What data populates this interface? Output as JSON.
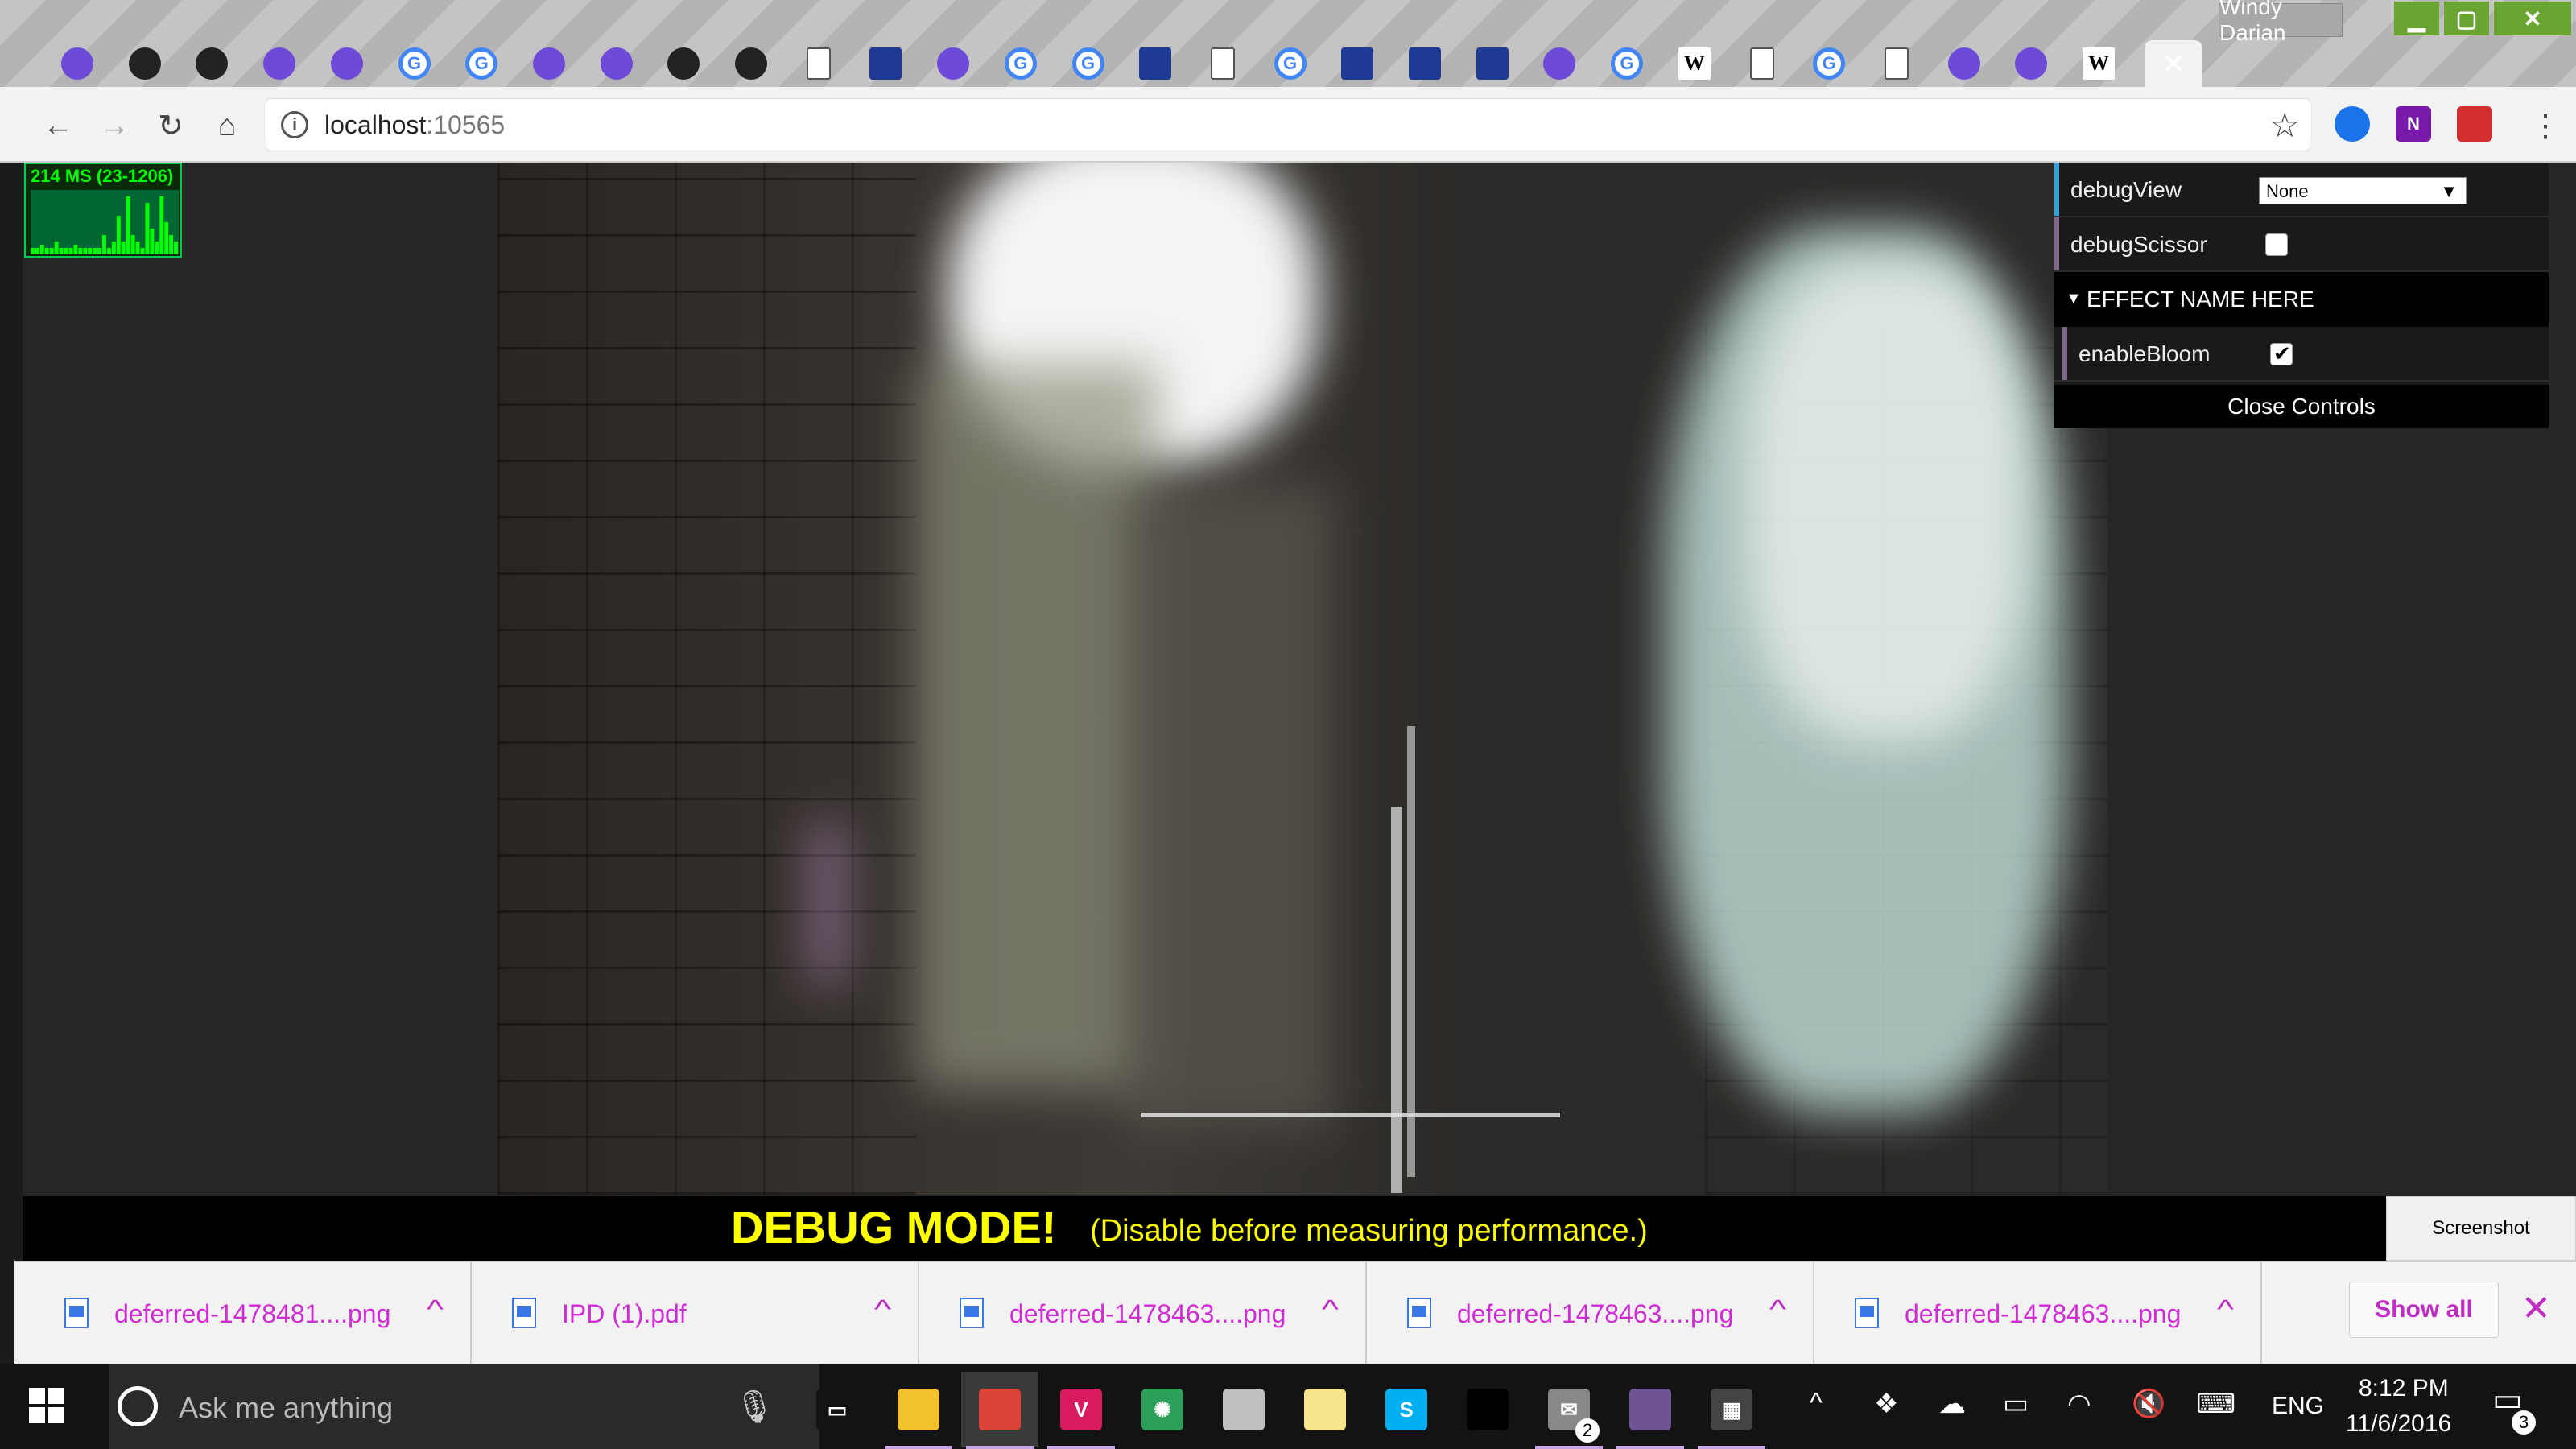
{
  "window": {
    "user_name": "Windy Darian",
    "tabs": [
      {
        "icon": "anime-avatar-icon",
        "kind": "misc",
        "glyph": ""
      },
      {
        "icon": "github-icon",
        "kind": "gh",
        "glyph": ""
      },
      {
        "icon": "github-icon",
        "kind": "gh",
        "glyph": ""
      },
      {
        "icon": "intel-icon",
        "kind": "misc",
        "glyph": ""
      },
      {
        "icon": "matlab-icon",
        "kind": "misc",
        "glyph": ""
      },
      {
        "icon": "google-icon",
        "kind": "g",
        "glyph": "G"
      },
      {
        "icon": "google-icon",
        "kind": "g",
        "glyph": "G"
      },
      {
        "icon": "nvidia-icon",
        "kind": "misc",
        "glyph": ""
      },
      {
        "icon": "ghost-icon",
        "kind": "misc",
        "glyph": ""
      },
      {
        "icon": "github-icon",
        "kind": "gh",
        "glyph": ""
      },
      {
        "icon": "github-icon",
        "kind": "gh",
        "glyph": ""
      },
      {
        "icon": "document-icon",
        "kind": "doc",
        "glyph": ""
      },
      {
        "icon": "penn-shield-icon",
        "kind": "shield",
        "glyph": ""
      },
      {
        "icon": "slides-icon",
        "kind": "misc",
        "glyph": ""
      },
      {
        "icon": "google-icon",
        "kind": "g",
        "glyph": "G"
      },
      {
        "icon": "google-icon",
        "kind": "g",
        "glyph": "G"
      },
      {
        "icon": "penn-shield-icon",
        "kind": "shield",
        "glyph": ""
      },
      {
        "icon": "document-icon",
        "kind": "doc",
        "glyph": ""
      },
      {
        "icon": "google-icon",
        "kind": "g",
        "glyph": "G"
      },
      {
        "icon": "penn-shield-icon",
        "kind": "shield",
        "glyph": ""
      },
      {
        "icon": "penn-shield-icon",
        "kind": "shield",
        "glyph": ""
      },
      {
        "icon": "penn-shield-icon",
        "kind": "shield",
        "glyph": ""
      },
      {
        "icon": "color-wheel-icon",
        "kind": "misc",
        "glyph": ""
      },
      {
        "icon": "google-icon",
        "kind": "g",
        "glyph": "G"
      },
      {
        "icon": "wikipedia-icon",
        "kind": "w",
        "glyph": "W"
      },
      {
        "icon": "document-icon",
        "kind": "doc",
        "glyph": ""
      },
      {
        "icon": "google-icon",
        "kind": "g",
        "glyph": "G"
      },
      {
        "icon": "document-icon",
        "kind": "doc",
        "glyph": ""
      },
      {
        "icon": "ring-logo-icon",
        "kind": "misc",
        "glyph": ""
      },
      {
        "icon": "stack-logo-icon",
        "kind": "misc",
        "glyph": ""
      },
      {
        "icon": "wikipedia-icon",
        "kind": "w",
        "glyph": "W"
      }
    ],
    "close_tab_glyph": "✕",
    "min_glyph": "▁",
    "max_glyph": "▢",
    "close_glyph": "✕"
  },
  "toolbar": {
    "back_glyph": "←",
    "forward_glyph": "→",
    "reload_glyph": "↻",
    "home_glyph": "⌂",
    "url_host": "localhost",
    "url_port": ":10565",
    "info_glyph": "i",
    "star_glyph": "☆",
    "menu_glyph": "⋮",
    "extensions": [
      {
        "icon": "circle-extension-icon",
        "color": "#1a73e8",
        "glyph": ""
      },
      {
        "icon": "onenote-icon",
        "color": "#7719aa",
        "glyph": "N"
      },
      {
        "icon": "red-book-icon",
        "color": "#d32f2f",
        "glyph": ""
      }
    ]
  },
  "stats": {
    "label": "214 MS (23-1206)",
    "bars": [
      0.1,
      0.1,
      0.15,
      0.1,
      0.1,
      0.2,
      0.1,
      0.1,
      0.1,
      0.15,
      0.1,
      0.1,
      0.1,
      0.1,
      0.1,
      0.3,
      0.1,
      0.2,
      0.6,
      0.2,
      0.9,
      0.3,
      0.2,
      0.1,
      0.8,
      0.4,
      0.2,
      0.9,
      0.5,
      0.3,
      0.2
    ]
  },
  "gui": {
    "debugview_label": "debugView",
    "debugview_value": "None",
    "debugscissor_label": "debugScissor",
    "debugscissor_checked": false,
    "folder_label": "EFFECT NAME HERE",
    "enablebloom_label": "enableBloom",
    "enablebloom_checked": true,
    "close_label": "Close Controls"
  },
  "debug_bar": {
    "title": "DEBUG MODE!",
    "note": "(Disable before measuring performance.)",
    "screenshot_label": "Screenshot"
  },
  "downloads": {
    "items": [
      {
        "name": "deferred-1478481....png"
      },
      {
        "name": "IPD (1).pdf"
      },
      {
        "name": "deferred-1478463....png"
      },
      {
        "name": "deferred-1478463....png"
      },
      {
        "name": "deferred-1478463....png"
      }
    ],
    "chevron_glyph": "^",
    "show_all": "Show all",
    "close_glyph": "✕"
  },
  "taskbar": {
    "search_placeholder": "Ask me anything",
    "mic_glyph": "🎙",
    "apps": [
      {
        "icon": "task-view-icon",
        "color": "#131313",
        "glyph": "▭",
        "running": false
      },
      {
        "icon": "file-explorer-icon",
        "color": "#f2c12e",
        "glyph": "",
        "running": true
      },
      {
        "icon": "chrome-icon",
        "color": "#db4437",
        "glyph": "",
        "running": true
      },
      {
        "icon": "visual-studio-icon",
        "color": "#d81b60",
        "glyph": "V",
        "running": true
      },
      {
        "icon": "atom-icon",
        "color": "#2e9e5b",
        "glyph": "✺",
        "running": false
      },
      {
        "icon": "paint-icon",
        "color": "#c0c0c0",
        "glyph": "",
        "running": false
      },
      {
        "icon": "sticky-notes-icon",
        "color": "#f6e58d",
        "glyph": "",
        "running": false
      },
      {
        "icon": "skype-icon",
        "color": "#00aff0",
        "glyph": "S",
        "running": false
      },
      {
        "icon": "terminal-icon",
        "color": "#000000",
        "glyph": "",
        "running": false
      },
      {
        "icon": "mail-icon",
        "color": "#888888",
        "glyph": "✉",
        "running": true
      },
      {
        "icon": "github-desktop-icon",
        "color": "#6e5494",
        "glyph": "",
        "running": true
      },
      {
        "icon": "calculator-icon",
        "color": "#444444",
        "glyph": "▦",
        "running": true
      }
    ],
    "mail_badge": "2",
    "tray": [
      {
        "icon": "chevron-up-icon",
        "glyph": "^"
      },
      {
        "icon": "dropbox-icon",
        "glyph": "❖"
      },
      {
        "icon": "onedrive-icon",
        "glyph": "☁"
      },
      {
        "icon": "battery-icon",
        "glyph": "▭"
      },
      {
        "icon": "wifi-icon",
        "glyph": "◠"
      },
      {
        "icon": "volume-muted-icon",
        "glyph": "🔇"
      },
      {
        "icon": "keyboard-icon",
        "glyph": "⌨"
      }
    ],
    "language": "ENG",
    "time": "8:12 PM",
    "date": "11/6/2016",
    "notification_count": "3"
  }
}
